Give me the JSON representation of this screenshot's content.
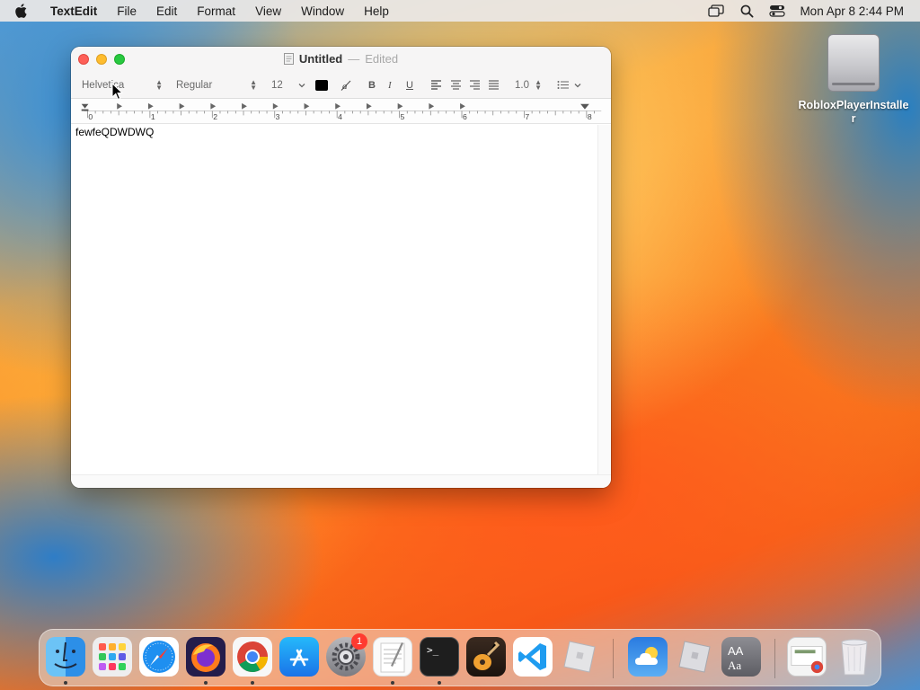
{
  "menubar": {
    "app_name": "TextEdit",
    "items": [
      "File",
      "Edit",
      "Format",
      "View",
      "Window",
      "Help"
    ],
    "clock": "Mon Apr 8  2:44 PM",
    "icons": [
      "apple-icon",
      "screen-mirroring-icon",
      "spotlight-search-icon",
      "control-center-icon"
    ]
  },
  "desktop": {
    "icon_label": "RobloxPlayerInstaller"
  },
  "window": {
    "title": "Untitled",
    "separator": "—",
    "status": "Edited",
    "toolbar": {
      "font_family": "Helvetica",
      "font_style": "Regular",
      "font_size": "12",
      "bold": "B",
      "italic": "I",
      "underline": "U",
      "line_spacing": "1.0",
      "text_color": "#000000"
    },
    "ruler": {
      "labels": [
        "0",
        "1",
        "2",
        "3",
        "4",
        "5",
        "6",
        "7",
        "8"
      ]
    },
    "document_text": "fewfeQDWDWQ"
  },
  "dock": {
    "apps": [
      {
        "name": "Finder",
        "running": true
      },
      {
        "name": "Launchpad",
        "running": false
      },
      {
        "name": "Safari",
        "running": false
      },
      {
        "name": "Firefox",
        "running": true
      },
      {
        "name": "Google Chrome",
        "running": true
      },
      {
        "name": "App Store",
        "running": false
      },
      {
        "name": "System Settings",
        "running": false,
        "badge": "1"
      },
      {
        "name": "TextEdit",
        "running": true
      },
      {
        "name": "Terminal",
        "running": true
      },
      {
        "name": "GarageBand",
        "running": false
      },
      {
        "name": "Visual Studio Code",
        "running": false
      },
      {
        "name": "Roblox",
        "running": false
      },
      {
        "name": "Weather",
        "running": false
      },
      {
        "name": "Roblox Studio",
        "running": false
      },
      {
        "name": "Font Book",
        "running": false
      },
      {
        "name": "Chrome Downloads",
        "running": false
      },
      {
        "name": "Trash",
        "running": false
      }
    ]
  },
  "colors": {
    "close": "#fe5f57",
    "minimize": "#febc2e",
    "maximize": "#28c840",
    "badge": "#ff3b30"
  }
}
